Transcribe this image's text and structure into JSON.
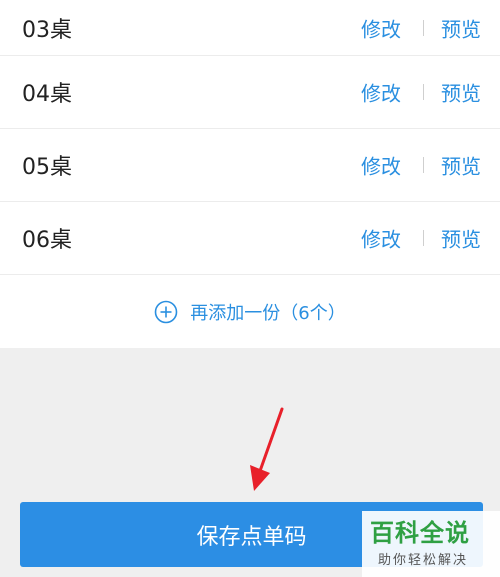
{
  "tables": [
    {
      "name": "03桌",
      "edit": "修改",
      "preview": "预览"
    },
    {
      "name": "04桌",
      "edit": "修改",
      "preview": "预览"
    },
    {
      "name": "05桌",
      "edit": "修改",
      "preview": "预览"
    },
    {
      "name": "06桌",
      "edit": "修改",
      "preview": "预览"
    }
  ],
  "add_more": {
    "label": "再添加一份（6个）",
    "icon": "plus-circle-icon"
  },
  "save_button": {
    "label": "保存点单码"
  },
  "watermark": {
    "title": "百科全说",
    "subtitle": "助你轻松解决"
  },
  "colors": {
    "accent": "#2a8fe0",
    "button": "#2c8ee4",
    "watermark": "#2fa043",
    "arrow": "#e8202a"
  }
}
